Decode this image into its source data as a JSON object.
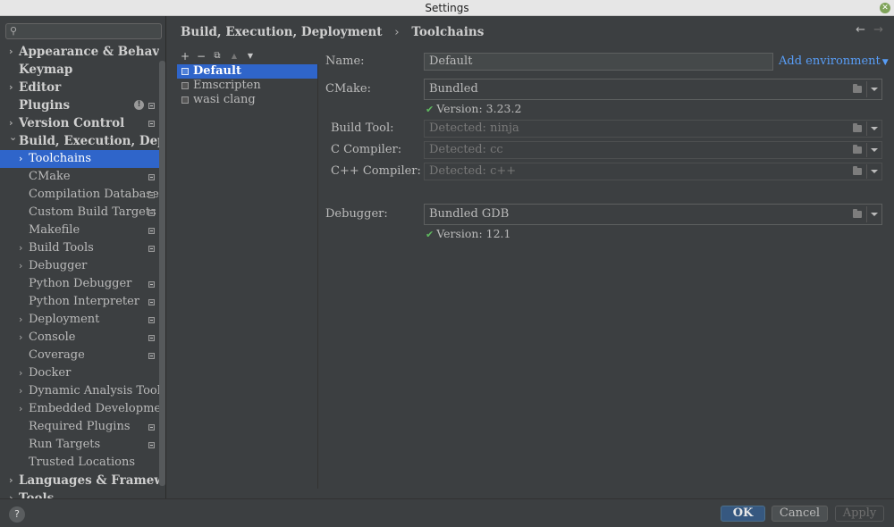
{
  "window": {
    "title": "Settings"
  },
  "sidebar": {
    "search_placeholder": "",
    "items": [
      {
        "label": "Appearance & Behavior",
        "level": 0,
        "bold": true,
        "chevron": "right"
      },
      {
        "label": "Keymap",
        "level": 0,
        "bold": true,
        "chevron": ""
      },
      {
        "label": "Editor",
        "level": 0,
        "bold": true,
        "chevron": "right"
      },
      {
        "label": "Plugins",
        "level": 0,
        "bold": true,
        "chevron": "",
        "badge": "!"
      },
      {
        "label": "Version Control",
        "level": 0,
        "bold": true,
        "chevron": "right"
      },
      {
        "label": "Build, Execution, Deployment",
        "level": 0,
        "bold": true,
        "chevron": "down"
      },
      {
        "label": "Toolchains",
        "level": 1,
        "chevron": "right",
        "selected": true
      },
      {
        "label": "CMake",
        "level": 1,
        "chevron": ""
      },
      {
        "label": "Compilation Database",
        "level": 1,
        "chevron": ""
      },
      {
        "label": "Custom Build Targets",
        "level": 1,
        "chevron": ""
      },
      {
        "label": "Makefile",
        "level": 1,
        "chevron": ""
      },
      {
        "label": "Build Tools",
        "level": 1,
        "chevron": "right"
      },
      {
        "label": "Debugger",
        "level": 1,
        "chevron": "right"
      },
      {
        "label": "Python Debugger",
        "level": 1,
        "chevron": ""
      },
      {
        "label": "Python Interpreter",
        "level": 1,
        "chevron": ""
      },
      {
        "label": "Deployment",
        "level": 1,
        "chevron": "right"
      },
      {
        "label": "Console",
        "level": 1,
        "chevron": "right"
      },
      {
        "label": "Coverage",
        "level": 1,
        "chevron": ""
      },
      {
        "label": "Docker",
        "level": 1,
        "chevron": "right"
      },
      {
        "label": "Dynamic Analysis Tools",
        "level": 1,
        "chevron": "right"
      },
      {
        "label": "Embedded Development",
        "level": 1,
        "chevron": "right"
      },
      {
        "label": "Required Plugins",
        "level": 1,
        "chevron": ""
      },
      {
        "label": "Run Targets",
        "level": 1,
        "chevron": ""
      },
      {
        "label": "Trusted Locations",
        "level": 1,
        "chevron": ""
      },
      {
        "label": "Languages & Frameworks",
        "level": 0,
        "bold": true,
        "chevron": "right"
      },
      {
        "label": "Tools",
        "level": 0,
        "bold": true,
        "chevron": "right"
      }
    ],
    "marked": [
      4,
      7,
      8,
      9,
      10,
      11,
      13,
      14,
      15,
      16,
      17,
      21,
      22
    ]
  },
  "header": {
    "breadcrumb_parent": "Build, Execution, Deployment",
    "breadcrumb_separator": "›",
    "breadcrumb_current": "Toolchains",
    "back_icon": "arrow-left-icon",
    "forward_icon": "arrow-right-icon"
  },
  "toolchains": {
    "toolbar": {
      "add": "+",
      "remove": "−",
      "copy": "⧉",
      "up": "▲",
      "down": "▼"
    },
    "items": [
      {
        "label": "Default",
        "selected": true
      },
      {
        "label": "Emscripten",
        "selected": false
      },
      {
        "label": "wasi clang",
        "selected": false
      }
    ]
  },
  "form": {
    "name_label": "Name:",
    "name_value": "Default",
    "add_environment": "Add environment",
    "cmake_label": "CMake:",
    "cmake_value": "Bundled",
    "cmake_version": "Version: 3.23.2",
    "build_tool_label": "Build Tool:",
    "build_tool_value": "Detected: ninja",
    "c_compiler_label": "C Compiler:",
    "c_compiler_value": "Detected: cc",
    "cpp_compiler_label": "C++ Compiler:",
    "cpp_compiler_value": "Detected: c++",
    "debugger_label": "Debugger:",
    "debugger_value": "Bundled GDB",
    "debugger_version": "Version: 12.1"
  },
  "footer": {
    "help": "?",
    "ok": "OK",
    "cancel": "Cancel",
    "apply": "Apply"
  },
  "colors": {
    "background": "#3c3f41",
    "selection": "#2f65ca",
    "link": "#589df6",
    "primary_button": "#365880",
    "check": "#5fb85f"
  }
}
